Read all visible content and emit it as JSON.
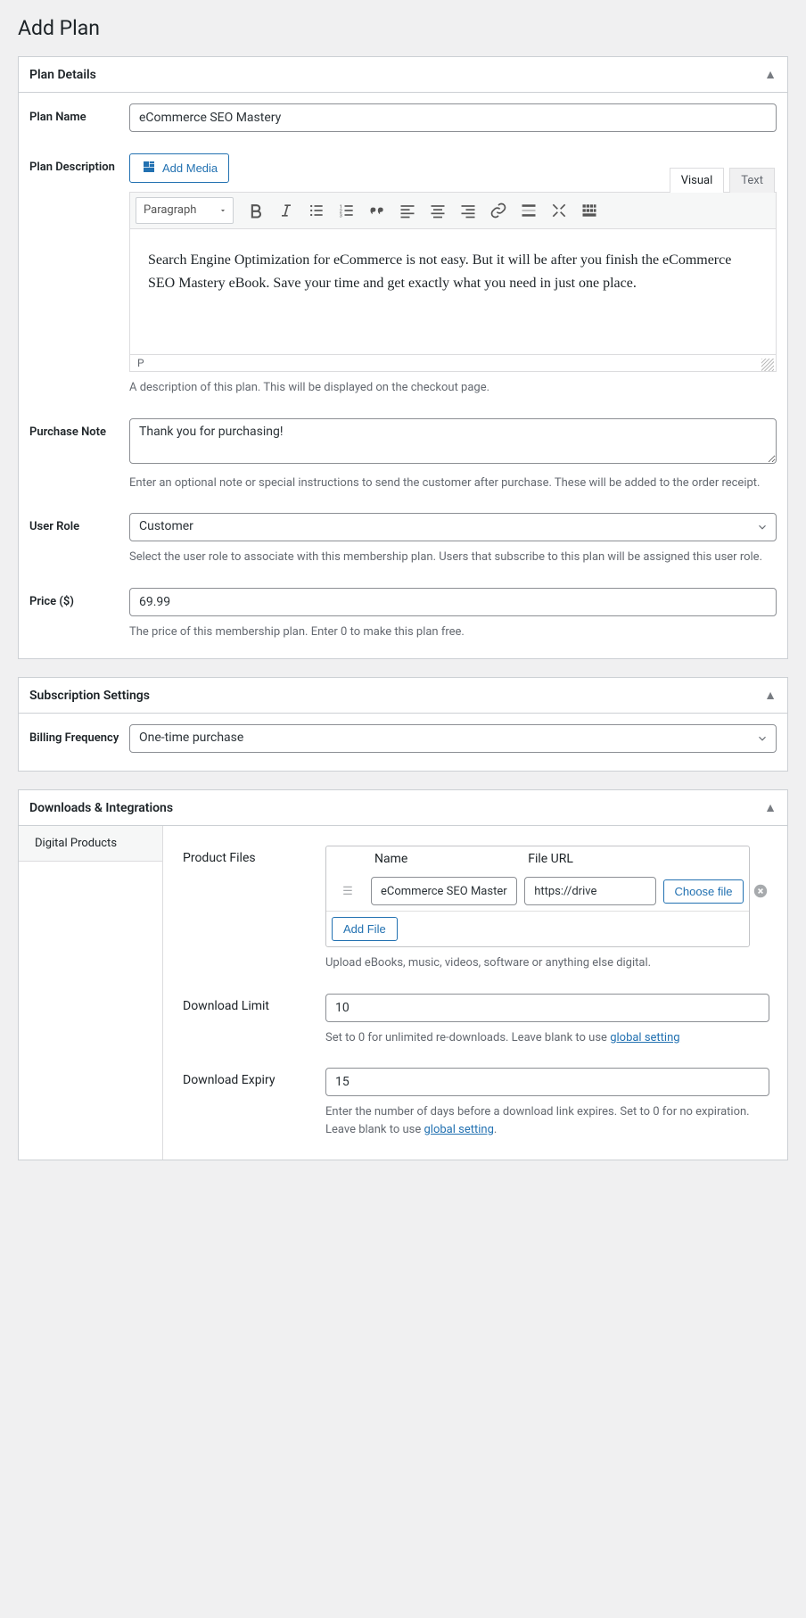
{
  "page_title": "Add Plan",
  "panels": {
    "details": {
      "title": "Plan Details"
    },
    "subscription": {
      "title": "Subscription Settings"
    },
    "downloads": {
      "title": "Downloads & Integrations"
    }
  },
  "plan_name": {
    "label": "Plan Name",
    "value": "eCommerce SEO Mastery"
  },
  "plan_description": {
    "label": "Plan Description",
    "add_media": "Add Media",
    "tab_visual": "Visual",
    "tab_text": "Text",
    "format_select": "Paragraph",
    "content": "Search Engine Optimization for eCommerce is not easy. But it will be after you finish the eCommerce SEO Mastery eBook. Save your time and get exactly what you need in just one place.",
    "status_path": "P",
    "help": "A description of this plan. This will be displayed on the checkout page."
  },
  "purchase_note": {
    "label": "Purchase Note",
    "value": "Thank you for purchasing!",
    "help": "Enter an optional note or special instructions to send the customer after purchase. These will be added to the order receipt."
  },
  "user_role": {
    "label": "User Role",
    "value": "Customer",
    "help": "Select the user role to associate with this membership plan. Users that subscribe to this plan will be assigned this user role."
  },
  "price": {
    "label": "Price ($)",
    "value": "69.99",
    "help": "The price of this membership plan. Enter 0 to make this plan free."
  },
  "billing_frequency": {
    "label": "Billing Frequency",
    "value": "One-time purchase"
  },
  "downloads": {
    "subtab": "Digital Products",
    "product_files": {
      "label": "Product Files",
      "col_name": "Name",
      "col_url": "File URL",
      "row": {
        "name": "eCommerce SEO Mastery",
        "url": "https://drive"
      },
      "choose_file": "Choose file",
      "add_file": "Add File",
      "help": "Upload eBooks, music, videos, software or anything else digital."
    },
    "download_limit": {
      "label": "Download Limit",
      "value": "10",
      "help_before": "Set to 0 for unlimited re-downloads. Leave blank to use ",
      "link": "global setting"
    },
    "download_expiry": {
      "label": "Download Expiry",
      "value": "15",
      "help_before": "Enter the number of days before a download link expires. Set to 0 for no expiration. Leave blank to use ",
      "link": "global setting",
      "help_after": "."
    }
  },
  "toolbar_icons": {
    "bold": "bold-icon",
    "italic": "italic-icon",
    "ul": "bullet-list-icon",
    "ol": "numbered-list-icon",
    "quote": "blockquote-icon",
    "align_left": "align-left-icon",
    "align_center": "align-center-icon",
    "align_right": "align-right-icon",
    "link": "link-icon",
    "more": "read-more-icon",
    "fullscreen": "fullscreen-icon",
    "toolbar_toggle": "toolbar-toggle-icon"
  }
}
